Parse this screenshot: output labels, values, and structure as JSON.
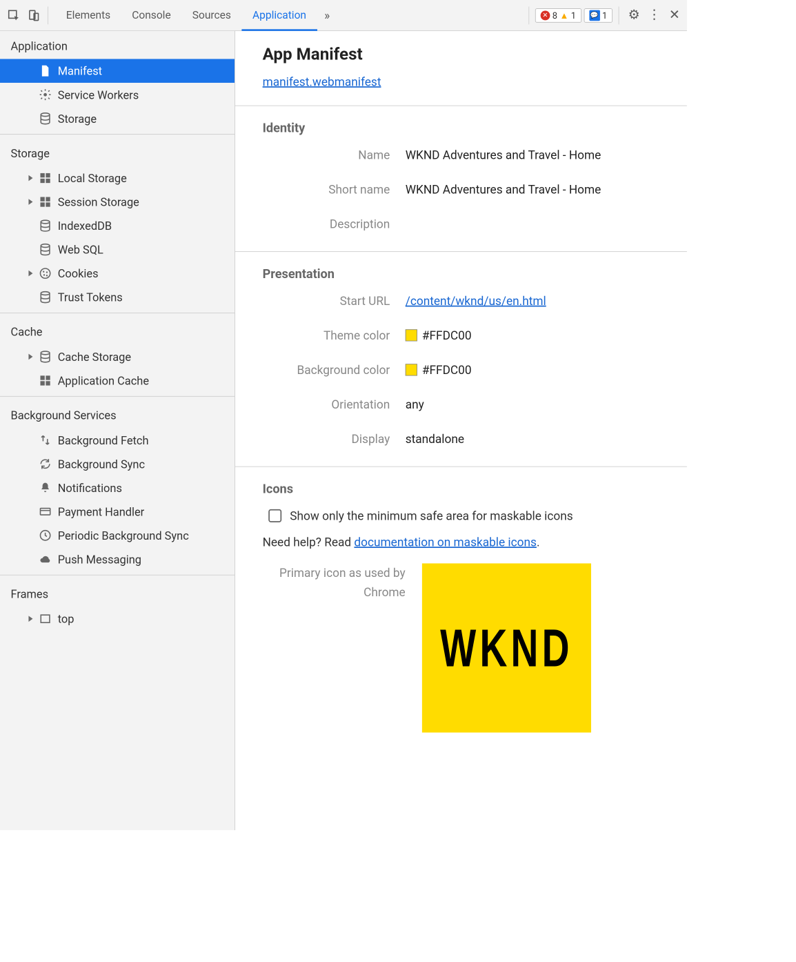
{
  "toolbar": {
    "tabs": [
      "Elements",
      "Console",
      "Sources",
      "Application"
    ],
    "active_tab": "Application",
    "error_count": "8",
    "warning_count": "1",
    "message_count": "1"
  },
  "sidebar": {
    "groups": [
      {
        "title": "Application",
        "items": [
          {
            "icon": "file",
            "label": "Manifest",
            "active": true,
            "expandable": false
          },
          {
            "icon": "gear",
            "label": "Service Workers",
            "expandable": false
          },
          {
            "icon": "db",
            "label": "Storage",
            "expandable": false
          }
        ]
      },
      {
        "title": "Storage",
        "items": [
          {
            "icon": "grid",
            "label": "Local Storage",
            "expandable": true
          },
          {
            "icon": "grid",
            "label": "Session Storage",
            "expandable": true
          },
          {
            "icon": "db",
            "label": "IndexedDB",
            "expandable": false
          },
          {
            "icon": "db",
            "label": "Web SQL",
            "expandable": false
          },
          {
            "icon": "cookie",
            "label": "Cookies",
            "expandable": true
          },
          {
            "icon": "db",
            "label": "Trust Tokens",
            "expandable": false
          }
        ]
      },
      {
        "title": "Cache",
        "items": [
          {
            "icon": "db",
            "label": "Cache Storage",
            "expandable": true
          },
          {
            "icon": "grid",
            "label": "Application Cache",
            "expandable": false
          }
        ]
      },
      {
        "title": "Background Services",
        "items": [
          {
            "icon": "updown",
            "label": "Background Fetch",
            "expandable": false
          },
          {
            "icon": "sync",
            "label": "Background Sync",
            "expandable": false
          },
          {
            "icon": "bell",
            "label": "Notifications",
            "expandable": false
          },
          {
            "icon": "card",
            "label": "Payment Handler",
            "expandable": false
          },
          {
            "icon": "clock",
            "label": "Periodic Background Sync",
            "expandable": false
          },
          {
            "icon": "cloud",
            "label": "Push Messaging",
            "expandable": false
          }
        ]
      },
      {
        "title": "Frames",
        "items": [
          {
            "icon": "frame",
            "label": "top",
            "expandable": true
          }
        ]
      }
    ]
  },
  "content": {
    "heading": "App Manifest",
    "manifest_link": "manifest.webmanifest",
    "identity_section": "Identity",
    "identity": {
      "name_label": "Name",
      "name_value": "WKND Adventures and Travel - Home",
      "shortname_label": "Short name",
      "shortname_value": "WKND Adventures and Travel - Home",
      "description_label": "Description",
      "description_value": ""
    },
    "presentation_section": "Presentation",
    "presentation": {
      "starturl_label": "Start URL",
      "starturl_value": "/content/wknd/us/en.html",
      "themecolor_label": "Theme color",
      "themecolor_value": "#FFDC00",
      "bgcolor_label": "Background color",
      "bgcolor_value": "#FFDC00",
      "orientation_label": "Orientation",
      "orientation_value": "any",
      "display_label": "Display",
      "display_value": "standalone"
    },
    "icons_section": "Icons",
    "checkbox_label": "Show only the minimum safe area for maskable icons",
    "help_prefix": "Need help? Read ",
    "help_link": "documentation on maskable icons",
    "help_suffix": ".",
    "primary_icon_label": "Primary icon as used by Chrome",
    "app_icon_text": "WKND",
    "app_icon_bg": "#FFDC00"
  }
}
